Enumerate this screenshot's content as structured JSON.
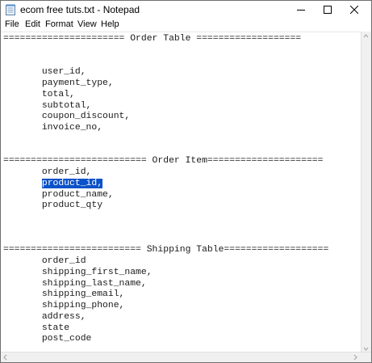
{
  "window": {
    "title": "ecom free tuts.txt - Notepad"
  },
  "icons": {
    "app": "notepad-icon",
    "minimize": "minimize-icon",
    "maximize": "maximize-icon",
    "close": "close-icon"
  },
  "menu": {
    "file": "File",
    "edit": "Edit",
    "format": "Format",
    "view": "View",
    "help": "Help"
  },
  "editor": {
    "lines": [
      "====================== Order Table ===================",
      "",
      "",
      "       user_id,",
      "       payment_type,",
      "       total,",
      "       subtotal,",
      "       coupon_discount,",
      "       invoice_no,",
      "",
      "",
      "========================== Order Item=====================",
      "       order_id,",
      "       product_id,",
      "       product_name,",
      "       product_qty",
      "",
      "",
      "",
      "========================= Shipping Table===================",
      "       order_id",
      "       shipping_first_name,",
      "       shipping_last_name,",
      "       shipping_email,",
      "       shipping_phone,",
      "       address,",
      "       state",
      "       post_code"
    ],
    "selection": {
      "line": 13,
      "indent": "       ",
      "text": "product_id,"
    }
  },
  "colors": {
    "selection": "#0a52c8",
    "text": "#1a1a1a",
    "scrollbar": "#f0f0f0"
  }
}
